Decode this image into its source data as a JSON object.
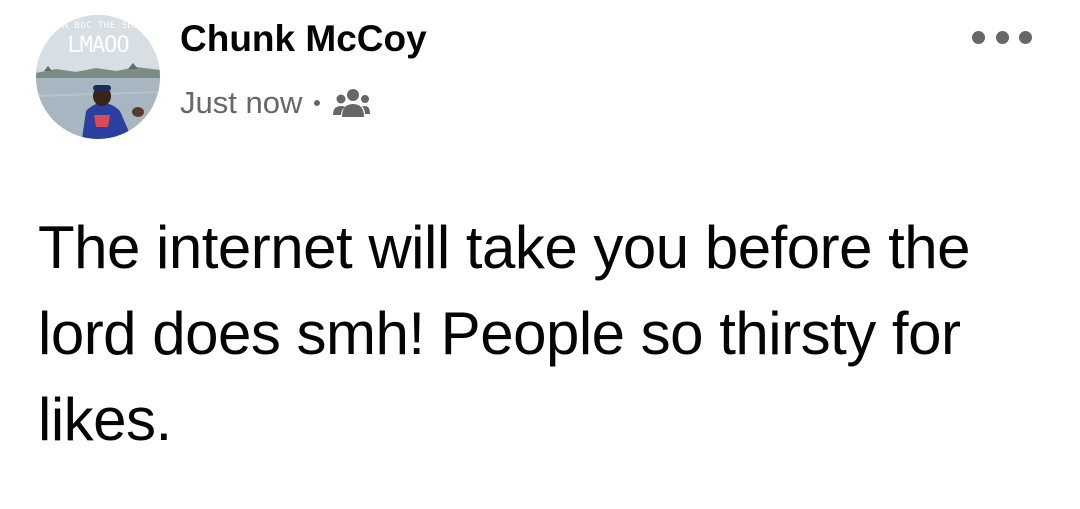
{
  "post": {
    "author": {
      "name": "Chunk McCoy",
      "avatar_caption": "ON BOC THE SHI",
      "avatar_watermark": "LMAOO"
    },
    "meta": {
      "timestamp": "Just now",
      "audience_icon": "friends-icon"
    },
    "menu_icon": "more-options-icon",
    "text": "The internet will take you before the lord does smh! People so thirsty for likes."
  },
  "colors": {
    "name": "#050505",
    "meta": "#65676b",
    "body_text": "#050505",
    "background": "#ffffff"
  }
}
